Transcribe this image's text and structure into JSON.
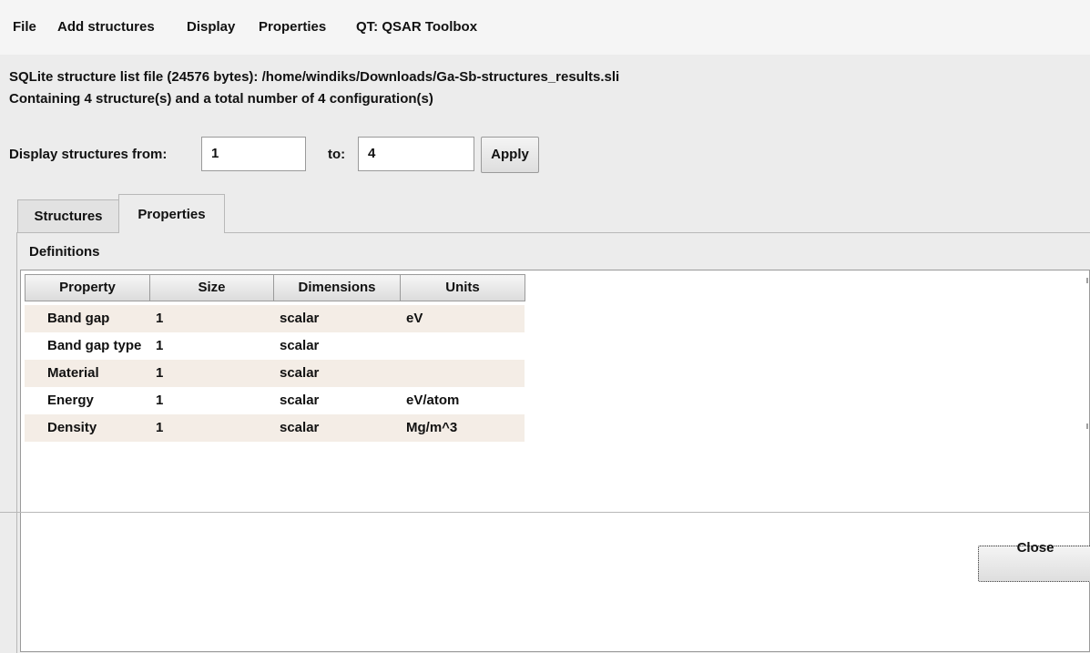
{
  "menubar": {
    "items": [
      "File",
      "Add structures",
      "Display",
      "Properties",
      "QT: QSAR Toolbox"
    ]
  },
  "info": {
    "file_line": "SQLite structure list file (24576 bytes):  /home/windiks/Downloads/Ga-Sb-structures_results.sli",
    "count_line": "Containing 4 structure(s) and a total number of 4 configuration(s)"
  },
  "range": {
    "from_label": "Display structures from:",
    "from_value": "1",
    "to_label": "to:",
    "to_value": "4",
    "apply_label": "Apply"
  },
  "tabs": {
    "structures": "Structures",
    "properties": "Properties",
    "active": "Properties"
  },
  "definitions": {
    "title": "Definitions",
    "columns": [
      "Property",
      "Size",
      "Dimensions",
      "Units"
    ],
    "rows": [
      {
        "property": "Band gap",
        "size": "1",
        "dimensions": "scalar",
        "units": "eV"
      },
      {
        "property": "Band gap type",
        "size": "1",
        "dimensions": "scalar",
        "units": ""
      },
      {
        "property": "Material",
        "size": "1",
        "dimensions": "scalar",
        "units": ""
      },
      {
        "property": "Energy",
        "size": "1",
        "dimensions": "scalar",
        "units": "eV/atom"
      },
      {
        "property": "Density",
        "size": "1",
        "dimensions": "scalar",
        "units": "Mg/m^3"
      }
    ]
  },
  "footer": {
    "close_label": "Close"
  }
}
